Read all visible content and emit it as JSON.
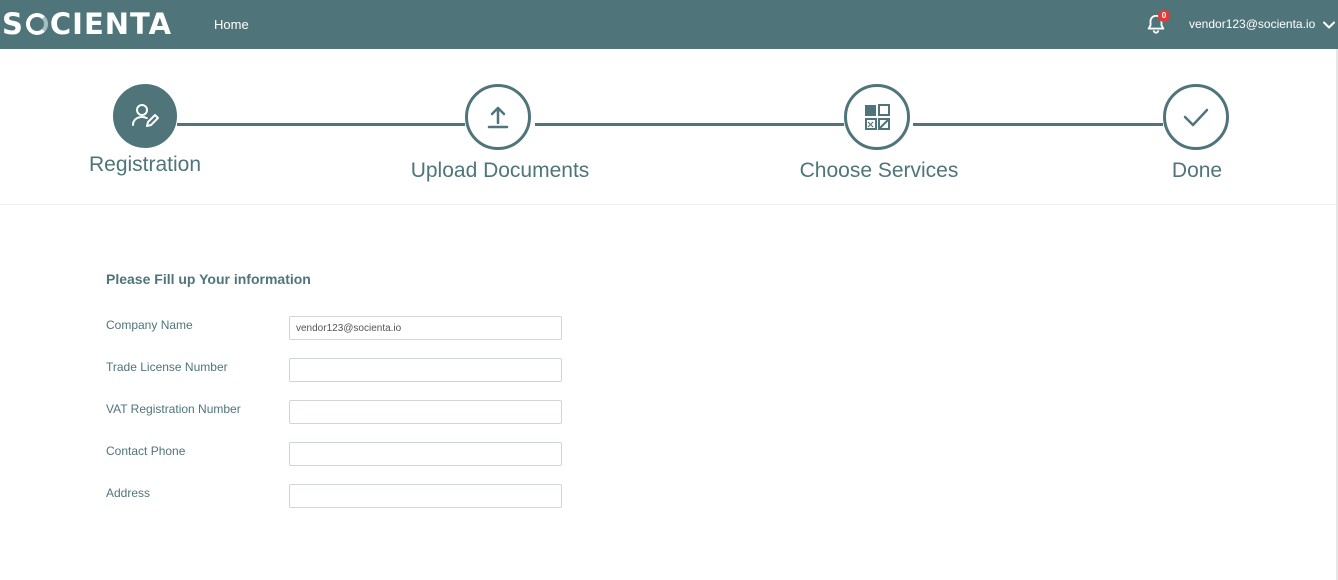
{
  "header": {
    "logo_text_prefix": "S",
    "logo_text_suffix": "CIENTA",
    "home_link": "Home",
    "notification_count": "0",
    "user_email": "vendor123@socienta.io"
  },
  "stepper": {
    "steps": [
      {
        "label": "Registration",
        "state": "active",
        "icon": "user-edit-icon"
      },
      {
        "label": "Upload Documents",
        "state": "pending",
        "icon": "upload-icon"
      },
      {
        "label": "Choose Services",
        "state": "pending",
        "icon": "services-grid-icon"
      },
      {
        "label": "Done",
        "state": "pending",
        "icon": "checkmark-icon"
      }
    ]
  },
  "form": {
    "title": "Please Fill up Your information",
    "fields": [
      {
        "label": "Company Name",
        "value": "vendor123@socienta.io"
      },
      {
        "label": "Trade License Number",
        "value": ""
      },
      {
        "label": "VAT Registration Number",
        "value": ""
      },
      {
        "label": "Contact Phone",
        "value": ""
      },
      {
        "label": "Address",
        "value": ""
      }
    ]
  },
  "colors": {
    "brand": "#4f757a",
    "badge": "#e53935",
    "background": "#ffffff"
  }
}
